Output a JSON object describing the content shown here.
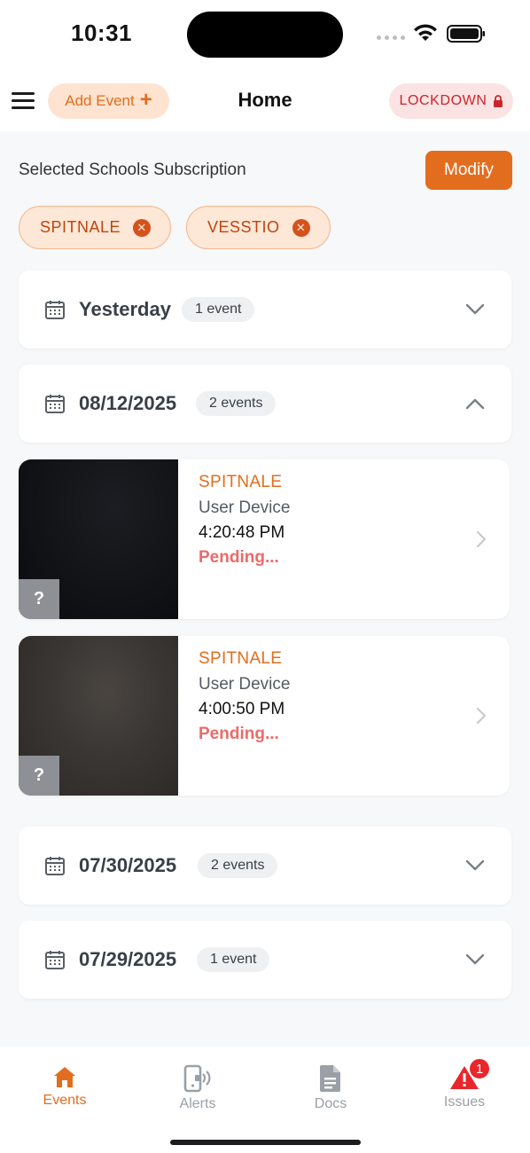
{
  "status_bar": {
    "time": "10:31"
  },
  "header": {
    "add_event_label": "Add Event",
    "title": "Home",
    "lockdown_label": "LOCKDOWN"
  },
  "subscriptions": {
    "title": "Selected Schools Subscription",
    "modify_label": "Modify",
    "chips": [
      "SPITNALE",
      "VESSTIO"
    ]
  },
  "groups": [
    {
      "date": "Yesterday",
      "count": "1 event",
      "expanded": false
    },
    {
      "date": "08/12/2025",
      "count": "2 events",
      "expanded": true
    },
    {
      "date": "07/30/2025",
      "count": "2 events",
      "expanded": false
    },
    {
      "date": "07/29/2025",
      "count": "1 event",
      "expanded": false
    }
  ],
  "events": [
    {
      "school": "SPITNALE",
      "device": "User Device",
      "time": "4:20:48 PM",
      "status": "Pending...",
      "thumb_icon": "question-mark-icon"
    },
    {
      "school": "SPITNALE",
      "device": "User Device",
      "time": "4:00:50 PM",
      "status": "Pending...",
      "thumb_icon": "question-mark-icon"
    }
  ],
  "bottom_nav": {
    "events": "Events",
    "alerts": "Alerts",
    "docs": "Docs",
    "issues": "Issues",
    "issues_badge": "1"
  },
  "colors": {
    "accent": "#e36d1e",
    "danger": "#c8262c",
    "pending": "#ec6a6a",
    "inactive_nav": "#9aa0a6"
  }
}
